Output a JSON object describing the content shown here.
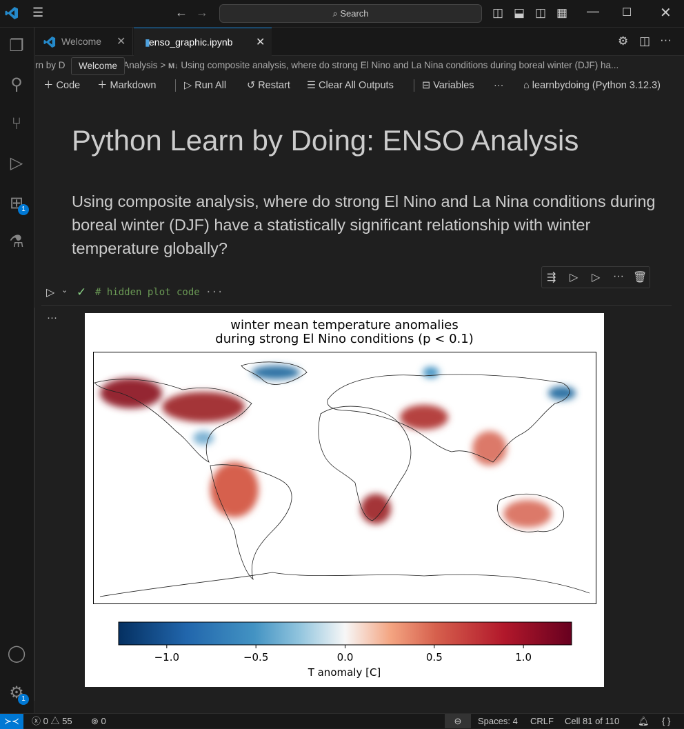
{
  "titlebar": {
    "search": "Search"
  },
  "activity": {
    "extensions_badge": "1",
    "settings_badge": "1"
  },
  "tabs": [
    {
      "label": "Welcome"
    },
    {
      "label": "enso_graphic.ipynb",
      "active": true
    }
  ],
  "breadcrumb": {
    "prefix": "rn by D",
    "section": "Analysis",
    "separator": ">",
    "md_icon": "M↓",
    "item": "Using composite analysis, where do strong El Nino and La Nina conditions during boreal winter (DJF) ha..."
  },
  "tooltip": "Welcome",
  "toolbar": {
    "code": "Code",
    "markdown": "Markdown",
    "run_all": "Run All",
    "restart": "Restart",
    "clear": "Clear All Outputs",
    "variables": "Variables",
    "more": "···",
    "kernel": "learnbydoing (Python 3.12.3)"
  },
  "notebook": {
    "title": "Python Learn by Doing: ENSO Analysis",
    "question": "Using composite analysis, where do strong El Nino and La Nina conditions during boreal winter (DJF) have a statistically significant relationship with winter temperature globally?",
    "code_cell": "# hidden plot code",
    "code_ellipsis": "···",
    "output_more": "···"
  },
  "chart_data": {
    "type": "heatmap",
    "title_line1": "winter mean temperature anomalies",
    "title_line2": "during strong El Nino conditions (p < 0.1)",
    "colorbar": {
      "label": "T anomaly [C]",
      "ticks": [
        "−1.0",
        "−0.5",
        "0.0",
        "0.5",
        "1.0"
      ],
      "range": [
        -1.27,
        1.27
      ],
      "colormap": "RdBu_r"
    },
    "regions": [
      {
        "name": "Alaska / NW Canada",
        "value": 1.0
      },
      {
        "name": "Central Canada",
        "value": 0.9
      },
      {
        "name": "Greenland south",
        "value": -0.8
      },
      {
        "name": "Gulf Coast US",
        "value": -0.4
      },
      {
        "name": "Northern South America",
        "value": 0.6
      },
      {
        "name": "Southern Africa",
        "value": 0.9
      },
      {
        "name": "Central Asia",
        "value": 0.8
      },
      {
        "name": "East Asia",
        "value": 0.5
      },
      {
        "name": "Eastern Siberia",
        "value": -0.8
      },
      {
        "name": "Australia",
        "value": 0.5
      },
      {
        "name": "Northern Scandinavia",
        "value": -0.6
      }
    ]
  },
  "colors": {
    "accent": "#0078d4",
    "code_comment": "#6a9955",
    "check": "#89d185"
  },
  "status": {
    "errors": "0",
    "warnings": "55",
    "ports": "0",
    "spaces": "Spaces: 4",
    "eol": "CRLF",
    "cell": "Cell 81 of 110"
  }
}
